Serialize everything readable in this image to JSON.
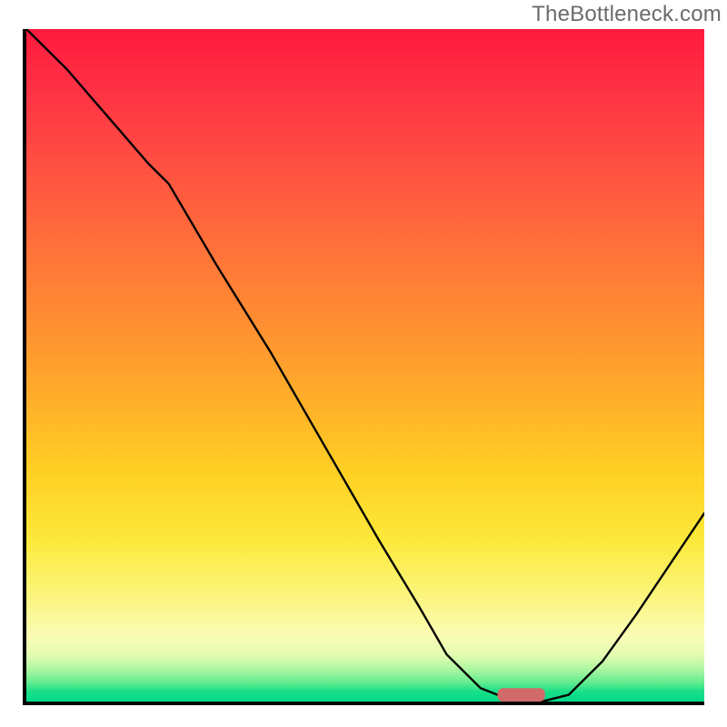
{
  "watermark": "TheBottleneck.com",
  "chart_data": {
    "type": "line",
    "title": "",
    "xlabel": "",
    "ylabel": "",
    "xlim": [
      0,
      100
    ],
    "ylim": [
      0,
      100
    ],
    "grid": false,
    "legend": false,
    "background_gradient": {
      "direction": "vertical",
      "stops": [
        {
          "pos": 0.0,
          "color": "#ff1a3c"
        },
        {
          "pos": 0.3,
          "color": "#ff6a3c"
        },
        {
          "pos": 0.66,
          "color": "#ffd024"
        },
        {
          "pos": 0.9,
          "color": "#fbfcb3"
        },
        {
          "pos": 1.0,
          "color": "#00d98a"
        }
      ]
    },
    "series": [
      {
        "name": "bottleneck-curve",
        "x": [
          0,
          6,
          12,
          18,
          21,
          28,
          36,
          44,
          52,
          58,
          62,
          67,
          72,
          76,
          80,
          85,
          90,
          96,
          100
        ],
        "y": [
          100,
          94,
          87,
          80,
          77,
          65,
          52,
          38,
          24,
          14,
          7,
          2,
          0,
          0,
          1,
          6,
          13,
          22,
          28
        ]
      }
    ],
    "marker": {
      "name": "optimal-point",
      "x": 73,
      "y": 1,
      "width": 7,
      "height": 2,
      "color": "#d36a6a",
      "shape": "rounded-rect"
    }
  }
}
